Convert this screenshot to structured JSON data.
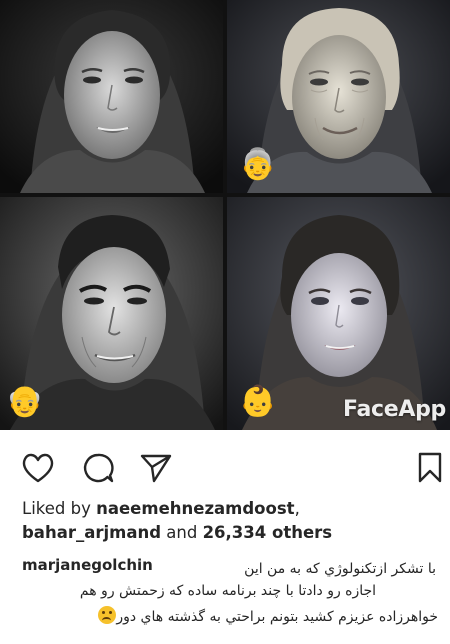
{
  "post": {
    "images": [
      {
        "emoji": "",
        "tone": "bw-young-woman"
      },
      {
        "emoji": "👵",
        "tone": "aged-woman"
      },
      {
        "emoji": "👴",
        "tone": "male-filter"
      },
      {
        "emoji": "👶",
        "tone": "young-filter"
      }
    ],
    "watermark": "FaceApp"
  },
  "actions": {
    "like_icon": "heart-icon",
    "comment_icon": "comment-icon",
    "share_icon": "send-icon",
    "save_icon": "bookmark-icon"
  },
  "likes": {
    "prefix": "Liked by ",
    "user1": "naeemehnezamdoost",
    "comma": ",",
    "user2": "bahar_arjmand",
    "and": " and ",
    "count": "26,334 others"
  },
  "caption": {
    "username": "marjanegolchin",
    "line1": "با تشکر ازتکنولوژي که به من اين",
    "line2": "اجازه رو دادتا با چند برنامه ساده که زحمتش رو هم",
    "line3": "خواهرزاده عزيزم کشيد بتونم براحتي به گذشته هاي دور"
  },
  "colors": {
    "text": "#262626",
    "emoji_face": "#f6c12b"
  }
}
